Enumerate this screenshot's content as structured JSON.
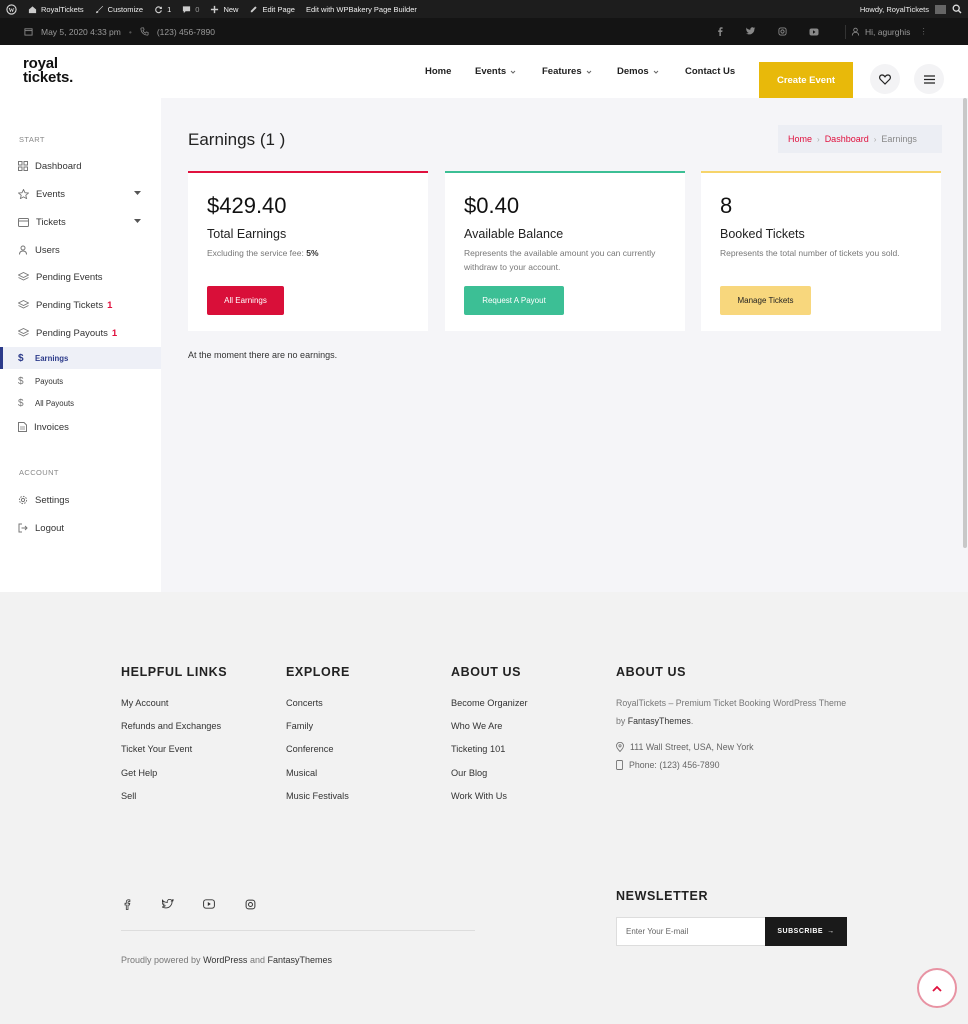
{
  "admin_bar": {
    "site": "RoyalTickets",
    "customize": "Customize",
    "updates": "1",
    "comments": "0",
    "new": "New",
    "edit_page": "Edit Page",
    "wpbakery": "Edit with WPBakery Page Builder",
    "howdy": "Howdy, RoyalTickets"
  },
  "info_bar": {
    "date": "May 5, 2020 4:33 pm",
    "phone": "(123) 456-7890",
    "user": "Hi, agurghis"
  },
  "header": {
    "logo_line1": "royal",
    "logo_line2": "tickets.",
    "nav": [
      "Home",
      "Events",
      "Features",
      "Demos",
      "Contact Us"
    ],
    "create_event": "Create Event"
  },
  "sidebar": {
    "start_label": "START",
    "account_label": "ACCOUNT",
    "items": [
      {
        "label": "Dashboard"
      },
      {
        "label": "Events"
      },
      {
        "label": "Tickets"
      },
      {
        "label": "Users"
      },
      {
        "label": "Pending Events"
      },
      {
        "label": "Pending Tickets",
        "badge": "1"
      },
      {
        "label": "Pending Payouts",
        "badge": "1"
      },
      {
        "label": "Earnings"
      },
      {
        "label": "Payouts"
      },
      {
        "label": "All Payouts"
      },
      {
        "label": "Invoices"
      }
    ],
    "account_items": [
      {
        "label": "Settings"
      },
      {
        "label": "Logout"
      }
    ]
  },
  "main": {
    "title": "Earnings (1 )",
    "breadcrumb": [
      "Home",
      "Dashboard",
      "Earnings"
    ],
    "cards": [
      {
        "amount": "$429.40",
        "title": "Total Earnings",
        "desc": "Excluding the service fee:",
        "desc_value": "5%",
        "button": "All Earnings",
        "accent": "#e0113e",
        "button_color": "#d90f39",
        "button_text_color": "#ffffff"
      },
      {
        "amount": "$0.40",
        "title": "Available Balance",
        "desc": "Represents the available amount you can currently withdraw to your account.",
        "button": "Request A Payout",
        "accent": "#3cbf95",
        "button_color": "#3cbf95",
        "button_text_color": "#ffffff"
      },
      {
        "amount": "8",
        "title": "Booked Tickets",
        "desc": "Represents the total number of tickets you sold.",
        "button": "Manage Tickets",
        "accent": "#f6d46a",
        "button_color": "#f8d77d",
        "button_text_color": "#222222"
      }
    ],
    "empty_message": "At the moment there are no earnings."
  },
  "footer": {
    "helpful_title": "HELPFUL LINKS",
    "helpful_links": [
      "My Account",
      "Refunds and Exchanges",
      "Ticket Your Event",
      "Get Help",
      "Sell"
    ],
    "explore_title": "EXPLORE",
    "explore_links": [
      "Concerts",
      "Family",
      "Conference",
      "Musical",
      "Music Festivals"
    ],
    "about_title": "ABOUT US",
    "about_links": [
      "Become Organizer",
      "Who We Are",
      "Ticketing 101",
      "Our Blog",
      "Work With Us"
    ],
    "about2_title": "ABOUT US",
    "about_text": "RoyalTickets – Premium Ticket Booking WordPress Theme by",
    "about_brand": "FantasyThemes",
    "address": "111 Wall Street, USA, New York",
    "phone": "Phone: (123) 456-7890",
    "newsletter_title": "NEWSLETTER",
    "newsletter_placeholder": "Enter Your E-mail",
    "subscribe": "SUBSCRIBE",
    "powered_prefix": "Proudly powered by",
    "powered_wp": "WordPress",
    "powered_and": "and",
    "powered_ft": "FantasyThemes"
  }
}
